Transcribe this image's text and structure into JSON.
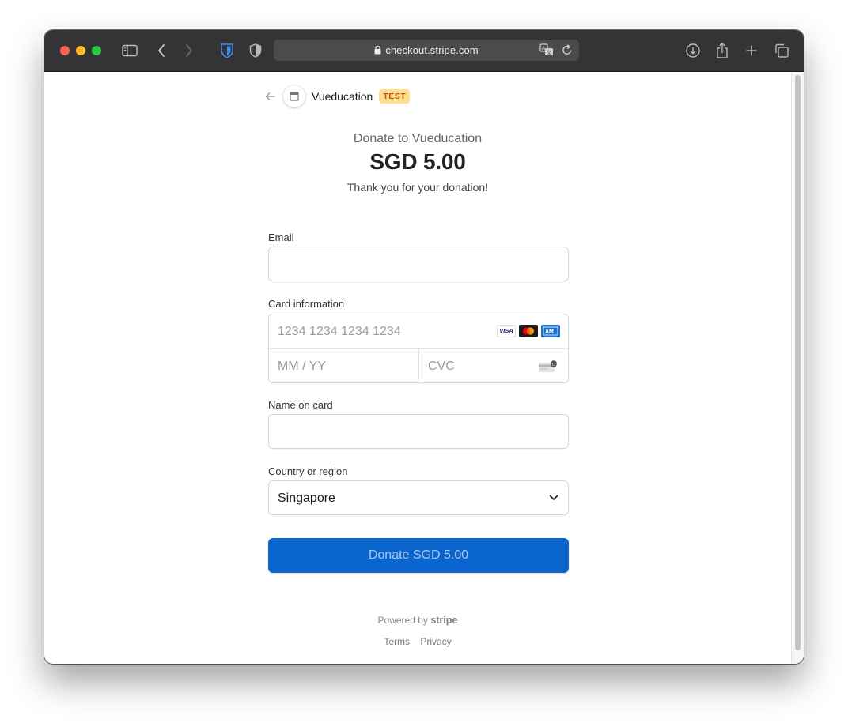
{
  "browser": {
    "url": "checkout.stripe.com"
  },
  "merchant": {
    "name": "Vueducation",
    "badge": "TEST"
  },
  "summary": {
    "title": "Donate to Vueducation",
    "amount": "SGD 5.00",
    "message": "Thank you for your donation!"
  },
  "form": {
    "email_label": "Email",
    "email_value": "",
    "card_label": "Card information",
    "card_number_placeholder": "1234 1234 1234 1234",
    "card_brands": [
      "VISA",
      "mastercard",
      "amex"
    ],
    "expiry_placeholder": "MM / YY",
    "cvc_placeholder": "CVC",
    "name_label": "Name on card",
    "name_value": "",
    "country_label": "Country or region",
    "country_value": "Singapore"
  },
  "submit_label": "Donate SGD 5.00",
  "footer": {
    "powered_by": "Powered by",
    "brand": "stripe",
    "terms": "Terms",
    "privacy": "Privacy"
  },
  "colors": {
    "accent": "#0a66ce",
    "badge_bg": "#ffde92",
    "badge_text": "#bb5504"
  }
}
